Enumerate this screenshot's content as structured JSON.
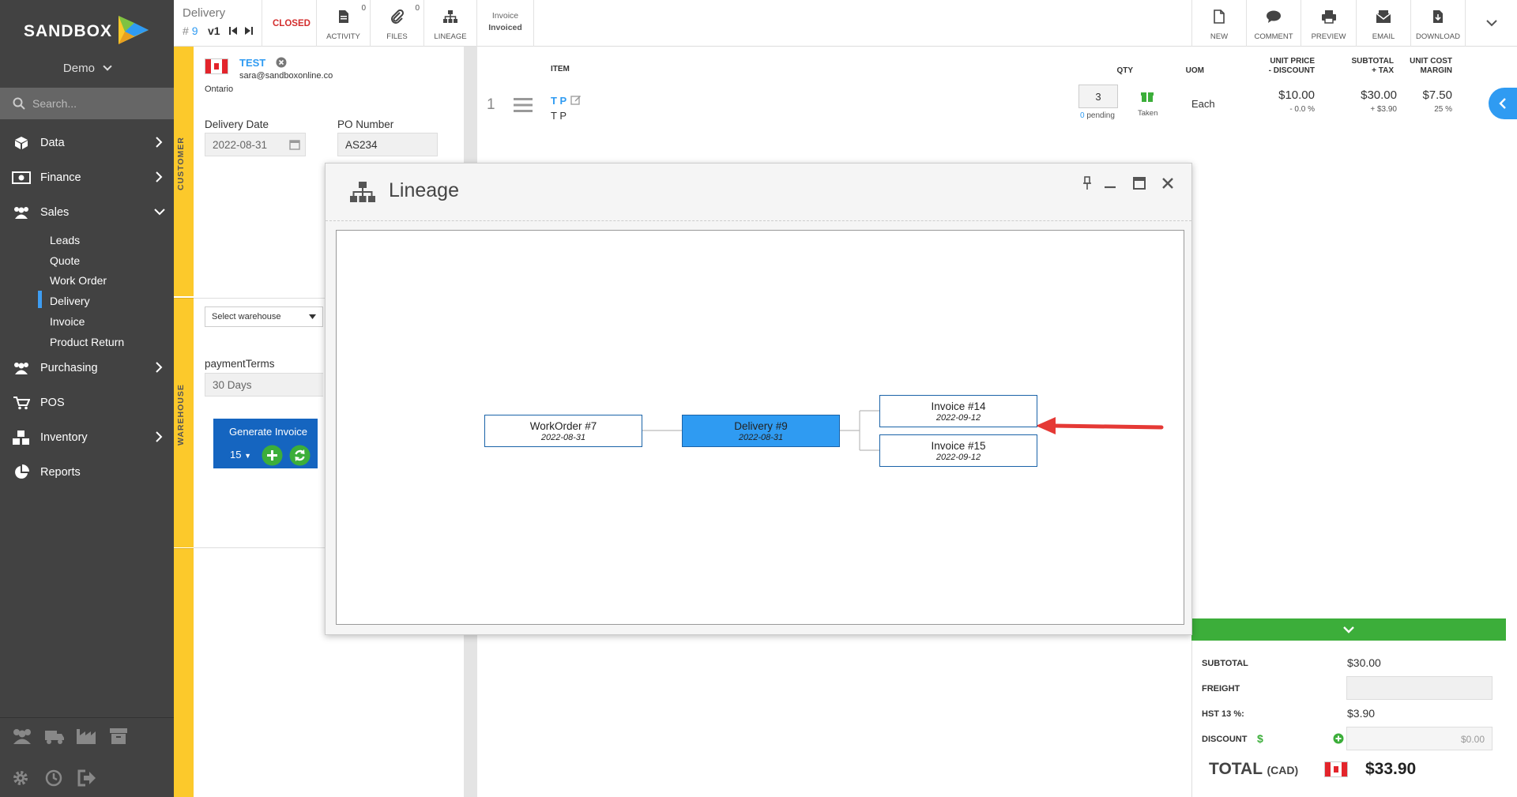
{
  "sidebar": {
    "brand": "SANDBOX",
    "account": "Demo",
    "search_placeholder": "Search...",
    "items": [
      {
        "label": "Data"
      },
      {
        "label": "Finance"
      },
      {
        "label": "Sales"
      },
      {
        "label": "Purchasing"
      },
      {
        "label": "POS"
      },
      {
        "label": "Inventory"
      },
      {
        "label": "Reports"
      }
    ],
    "sales_sub": [
      "Leads",
      "Quote",
      "Work Order",
      "Delivery",
      "Invoice",
      "Product Return"
    ],
    "active_sub": "Delivery"
  },
  "doc": {
    "type": "Delivery",
    "number": "9",
    "hash": "#",
    "version": "v1",
    "status": "CLOSED",
    "invoice_status_label": "Invoice",
    "invoice_status_value": "Invoiced"
  },
  "toolbar": {
    "activity_label": "ACTIVITY",
    "activity_count": "0",
    "files_label": "FILES",
    "files_count": "0",
    "lineage_label": "LINEAGE",
    "new_label": "NEW",
    "comment_label": "COMMENT",
    "preview_label": "PREVIEW",
    "email_label": "EMAIL",
    "download_label": "DOWNLOAD"
  },
  "customer": {
    "tab_label": "CUSTOMER",
    "name": "TEST",
    "email": "sara@sandboxonline.co",
    "region": "Ontario",
    "delivery_date_label": "Delivery Date",
    "delivery_date": "2022-08-31",
    "po_label": "PO Number",
    "po_value": "AS234"
  },
  "warehouse": {
    "tab_label": "WAREHOUSE",
    "select_placeholder": "Select warehouse",
    "payment_terms_label": "paymentTerms",
    "payment_terms_value": "30 Days",
    "generate_label": "Generate Invoice",
    "generate_count": "15"
  },
  "items": {
    "headers": {
      "item": "ITEM",
      "qty": "QTY",
      "uom": "UOM",
      "unit_price_1": "UNIT PRICE",
      "unit_price_2": "- DISCOUNT",
      "subtotal_1": "SUBTOTAL",
      "subtotal_2": "+ TAX",
      "unit_cost_1": "UNIT COST",
      "unit_cost_2": "MARGIN"
    },
    "rows": [
      {
        "index": "1",
        "code": "T P",
        "name": "T P",
        "qty": "3",
        "pending_count": "0",
        "pending_label": "pending",
        "taken_label": "Taken",
        "uom": "Each",
        "unit_price": "$10.00",
        "discount": "- 0.0 %",
        "subtotal": "$30.00",
        "tax": "+ $3.90",
        "unit_cost": "$7.50",
        "margin": "25 %"
      }
    ]
  },
  "lineage": {
    "title": "Lineage",
    "nodes": [
      {
        "label": "WorkOrder #7",
        "date": "2022-08-31"
      },
      {
        "label": "Delivery #9",
        "date": "2022-08-31"
      },
      {
        "label": "Invoice #14",
        "date": "2022-09-12"
      },
      {
        "label": "Invoice #15",
        "date": "2022-09-12"
      }
    ]
  },
  "totals": {
    "subtotal_label": "SUBTOTAL",
    "subtotal_value": "$30.00",
    "freight_label": "FREIGHT",
    "tax_label": "HST 13 %:",
    "tax_value": "$3.90",
    "discount_label": "DISCOUNT",
    "discount_symbol": "$",
    "discount_value": "$0.00",
    "total_label": "TOTAL",
    "currency": "(CAD)",
    "total_value": "$33.90"
  },
  "colors": {
    "sidebar": "#424242",
    "accent_blue": "#2f9bf2",
    "tab_yellow": "#fcc92b",
    "generate_blue": "#1565c0",
    "green": "#3cae3a",
    "status_red": "#d32f2f",
    "arrow_red": "#e53935"
  }
}
